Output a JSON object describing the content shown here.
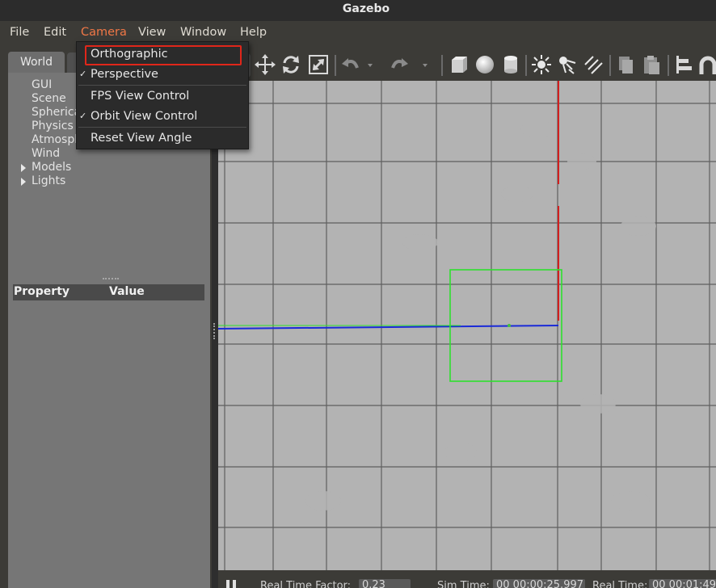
{
  "window": {
    "title": "Gazebo"
  },
  "menubar": {
    "items": [
      {
        "label": "File"
      },
      {
        "label": "Edit"
      },
      {
        "label": "Camera"
      },
      {
        "label": "View"
      },
      {
        "label": "Window"
      },
      {
        "label": "Help"
      }
    ]
  },
  "camera_menu": {
    "items": [
      {
        "label": "Orthographic",
        "checked": false,
        "highlighted": true
      },
      {
        "label": "Perspective",
        "checked": true
      },
      {
        "label": "FPS View Control",
        "checked": false
      },
      {
        "label": "Orbit View Control",
        "checked": true
      },
      {
        "label": "Reset View Angle",
        "checked": false
      }
    ],
    "check_glyph": "✓"
  },
  "left_panel": {
    "tab": "World",
    "tree": [
      {
        "label": "GUI"
      },
      {
        "label": "Scene"
      },
      {
        "label": "Spherical Coordinates"
      },
      {
        "label": "Physics"
      },
      {
        "label": "Atmosphere"
      },
      {
        "label": "Wind"
      },
      {
        "label": "Models",
        "expandable": true
      },
      {
        "label": "Lights",
        "expandable": true
      }
    ],
    "property_header": {
      "property": "Property",
      "value": "Value"
    }
  },
  "toolbar": {
    "icons": [
      "translate-icon",
      "rotate-icon",
      "scale-icon",
      "undo-icon",
      "redo-icon",
      "box-icon",
      "sphere-icon",
      "cylinder-icon",
      "point-light-icon",
      "spot-light-icon",
      "directional-light-icon",
      "copy-icon",
      "paste-icon",
      "align-icon",
      "snap-icon"
    ]
  },
  "bottom_bar": {
    "real_time_factor_label": "Real Time Factor:",
    "real_time_factor": "0.23",
    "sim_time_label": "Sim Time:",
    "sim_time": "00 00:00:25.997",
    "real_time_label": "Real Time:",
    "real_time": "00 00:01:49"
  },
  "colors": {
    "accent": "#f07746",
    "highlight_border": "#e0261a",
    "viewport_bg": "#b3b3b3",
    "x_axis": "#d21e1e",
    "y_axis": "#1a2ad8",
    "bbox": "#2ee02e"
  }
}
